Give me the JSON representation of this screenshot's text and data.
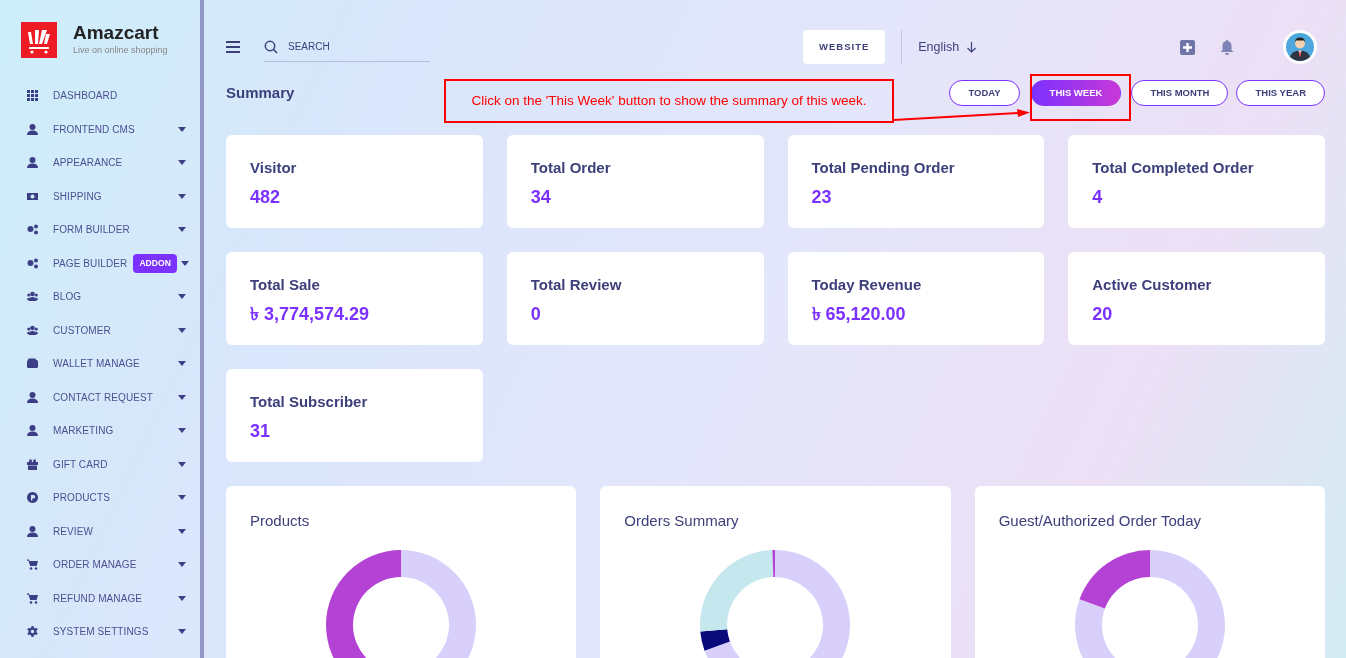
{
  "brand": {
    "name": "Amazcart",
    "tagline": "Live on online shopping"
  },
  "sidebar": {
    "items": [
      {
        "label": "DASHBOARD",
        "expandable": false
      },
      {
        "label": "FRONTEND CMS",
        "expandable": true
      },
      {
        "label": "APPEARANCE",
        "expandable": true
      },
      {
        "label": "SHIPPING",
        "expandable": true
      },
      {
        "label": "FORM BUILDER",
        "expandable": true
      },
      {
        "label": "PAGE BUILDER",
        "badge": "ADDON",
        "expandable": true
      },
      {
        "label": "BLOG",
        "expandable": true
      },
      {
        "label": "CUSTOMER",
        "expandable": true
      },
      {
        "label": "WALLET MANAGE",
        "expandable": true
      },
      {
        "label": "CONTACT REQUEST",
        "expandable": true
      },
      {
        "label": "MARKETING",
        "expandable": true
      },
      {
        "label": "GIFT CARD",
        "expandable": true
      },
      {
        "label": "PRODUCTS",
        "expandable": true
      },
      {
        "label": "REVIEW",
        "expandable": true
      },
      {
        "label": "ORDER MANAGE",
        "expandable": true
      },
      {
        "label": "REFUND MANAGE",
        "expandable": true
      },
      {
        "label": "SYSTEM SETTINGS",
        "expandable": true
      }
    ]
  },
  "topbar": {
    "search": {
      "placeholder": "SEARCH"
    },
    "website_button": "WEBSITE",
    "language": "English"
  },
  "summary": {
    "title": "Summary",
    "periods": [
      {
        "label": "TODAY",
        "selected": false
      },
      {
        "label": "THIS WEEK",
        "selected": true
      },
      {
        "label": "THIS MONTH",
        "selected": false
      },
      {
        "label": "THIS YEAR",
        "selected": false
      }
    ]
  },
  "stats": [
    {
      "label": "Visitor",
      "value": "482"
    },
    {
      "label": "Total Order",
      "value": "34"
    },
    {
      "label": "Total Pending Order",
      "value": "23"
    },
    {
      "label": "Total Completed Order",
      "value": "4"
    },
    {
      "label": "Total Sale",
      "value": "৳ 3,774,574.29"
    },
    {
      "label": "Total Review",
      "value": "0"
    },
    {
      "label": "Today Revenue",
      "value": "৳ 65,120.00"
    },
    {
      "label": "Active Customer",
      "value": "20"
    },
    {
      "label": "Total Subscriber",
      "value": "31"
    }
  ],
  "charts": [
    {
      "title": "Products"
    },
    {
      "title": "Orders Summary"
    },
    {
      "title": "Guest/Authorized Order Today"
    }
  ],
  "annotation": {
    "text": "Click on the 'This Week' button to show the summary of this week."
  }
}
